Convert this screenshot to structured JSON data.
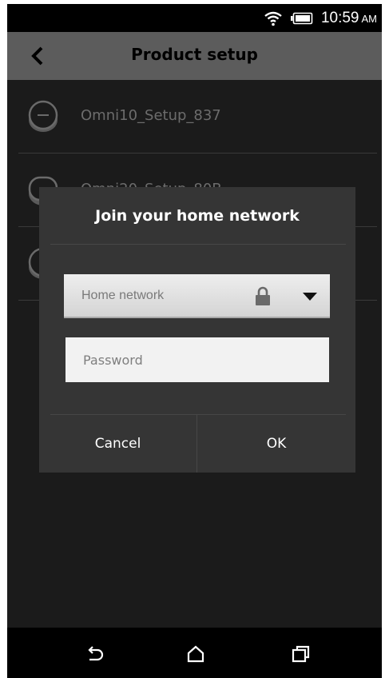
{
  "status_bar": {
    "time": "10:59",
    "ampm": "AM",
    "icons": [
      "wifi-icon",
      "battery-icon"
    ]
  },
  "app_bar": {
    "title": "Product setup",
    "back_icon": "chevron-left-icon"
  },
  "devices": [
    {
      "label": "Omni10_Setup_837",
      "icon": "speaker-icon"
    },
    {
      "label": "Omni20_Setup_80B",
      "icon": "speaker-icon"
    },
    {
      "label": "",
      "icon": "speaker-icon"
    }
  ],
  "dialog": {
    "title": "Join your home network",
    "network_select": {
      "value": "Home network",
      "lock_icon": "lock-icon",
      "dropdown_icon": "caret-down-icon"
    },
    "password": {
      "placeholder": "Password",
      "value": ""
    },
    "buttons": {
      "cancel": "Cancel",
      "ok": "OK"
    }
  },
  "nav_bar": {
    "icons": [
      "back-arrow-icon",
      "home-icon",
      "recents-icon"
    ]
  },
  "colors": {
    "app_bar": "#5c5c5c",
    "content_bg": "#1b1b1b",
    "dialog_bg": "#353535"
  }
}
